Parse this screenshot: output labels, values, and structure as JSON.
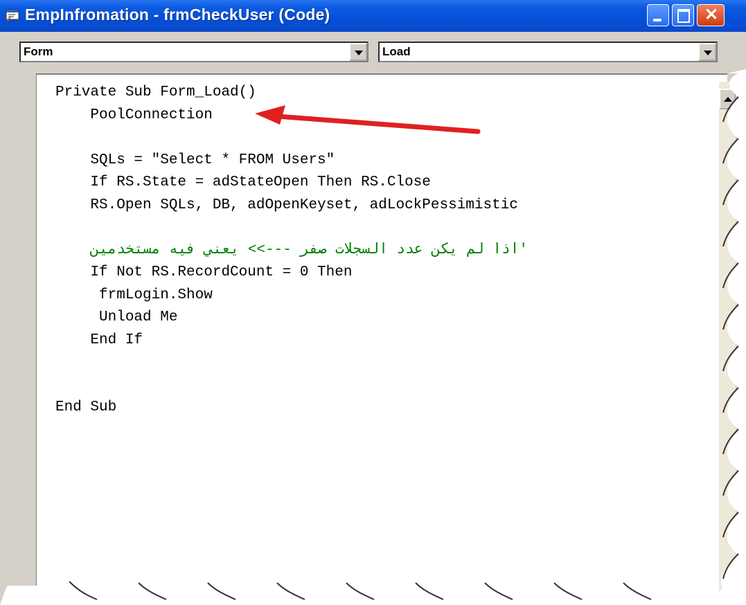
{
  "window": {
    "title": "EmpInfromation - frmCheckUser (Code)",
    "controls": [
      "minimize-icon",
      "maximize-icon",
      "close-icon"
    ]
  },
  "combos": {
    "object": {
      "value": "Form"
    },
    "procedure": {
      "value": "Load"
    }
  },
  "code": {
    "lines": [
      "Private Sub Form_Load()",
      "    PoolConnection",
      "",
      "    SQLs = \"Select * FROM Users\"",
      "    If RS.State = adStateOpen Then RS.Close",
      "    RS.Open SQLs, DB, adOpenKeyset, adLockPessimistic",
      "",
      "    اذا لم يكن عدد السجلات صفر --->> يعني فيه مستخدمين'",
      "    If Not RS.RecordCount = 0 Then",
      "     frmLogin.Show",
      "     Unload Me",
      "    End If",
      "",
      "",
      "End Sub"
    ],
    "comment_line_index": 7
  },
  "colors": {
    "titlebar": "#0a5ae0",
    "comment": "#008000",
    "annotation_arrow": "#e02020"
  }
}
